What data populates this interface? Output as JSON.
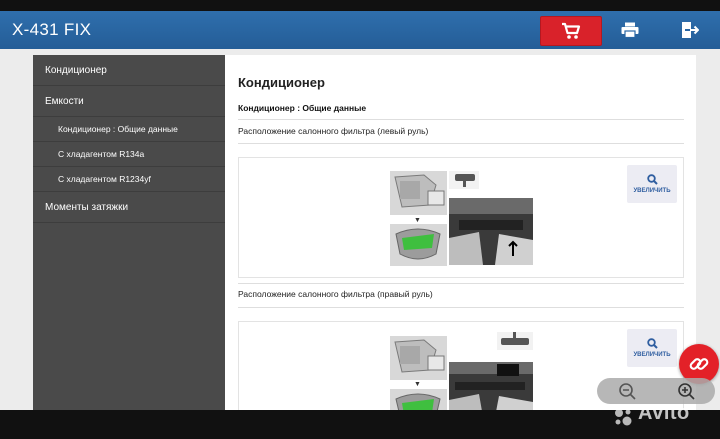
{
  "header": {
    "title": "X-431 FIX",
    "cart_icon": "cart-icon",
    "print_icon": "printer-icon",
    "exit_icon": "exit-icon",
    "accent_color": "#d9222a",
    "bar_color": "#2a66a3"
  },
  "sidebar": {
    "items": [
      {
        "label": "Кондиционер",
        "level": "main"
      },
      {
        "label": "Емкости",
        "level": "main"
      },
      {
        "label": "Кондиционер : Общие данные",
        "level": "sub"
      },
      {
        "label": "С хладагентом R134a",
        "level": "sub"
      },
      {
        "label": "С хладагентом R1234yf",
        "level": "sub"
      },
      {
        "label": "Моменты затяжки",
        "level": "main"
      }
    ]
  },
  "main": {
    "title": "Кондиционер",
    "subtitle": "Кондиционер : Общие данные",
    "sections": [
      {
        "label": "Расположение салонного фильтра (левый руль)",
        "zoom_label": "УВЕЛИЧИТЬ"
      },
      {
        "label": "Расположение салонного фильтра (правый руль)",
        "zoom_label": "УВЕЛИЧИТЬ"
      }
    ]
  },
  "overlay": {
    "link_icon": "link-icon",
    "zoom_out_icon": "zoom-out-icon",
    "zoom_in_icon": "zoom-in-icon",
    "watermark": "Avito"
  }
}
